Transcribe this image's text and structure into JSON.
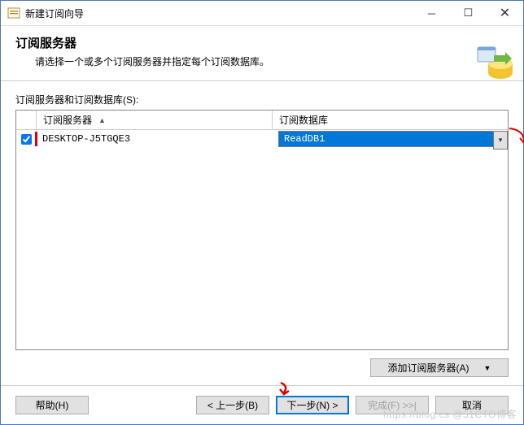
{
  "window": {
    "title": "新建订阅向导"
  },
  "header": {
    "title": "订阅服务器",
    "description": "请选择一个或多个订阅服务器并指定每个订阅数据库。"
  },
  "grid": {
    "label": "订阅服务器和订阅数据库(S):",
    "col_server": "订阅服务器",
    "col_database": "订阅数据库",
    "rows": [
      {
        "checked": true,
        "server": "DESKTOP-J5TGQE3",
        "database": "ReadDB1"
      }
    ]
  },
  "buttons": {
    "add_server": "添加订阅服务器(A)",
    "help": "帮助(H)",
    "back": "< 上一步(B)",
    "next": "下一步(N) >",
    "finish": "完成(F) >>|",
    "cancel": "取消"
  },
  "watermark": "https://blog.cs    @51CTO博客"
}
